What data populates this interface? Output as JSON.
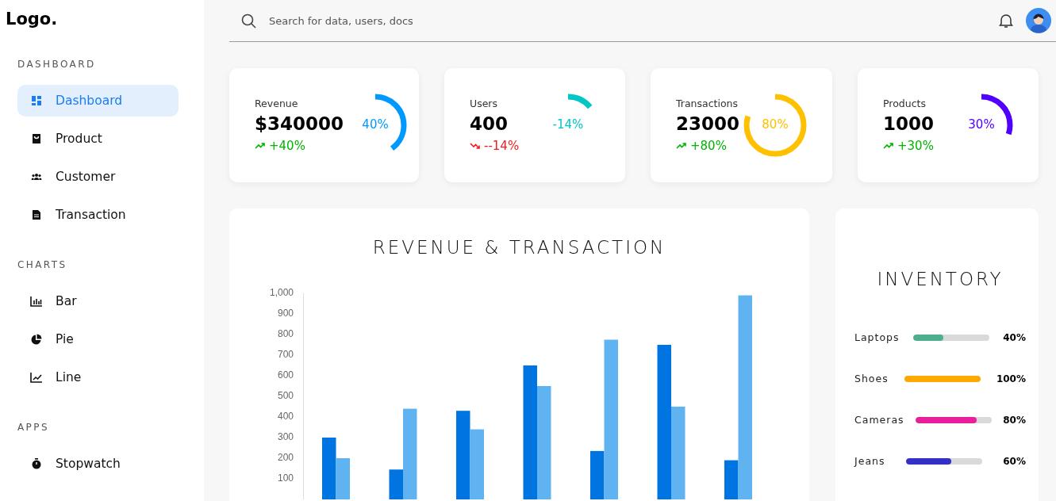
{
  "logo": "Logo.",
  "sidebar": {
    "sections": [
      {
        "title": "DASHBOARD",
        "items": [
          {
            "label": "Dashboard",
            "selected": true
          },
          {
            "label": "Product",
            "selected": false
          },
          {
            "label": "Customer",
            "selected": false
          },
          {
            "label": "Transaction",
            "selected": false
          }
        ]
      },
      {
        "title": "CHARTS",
        "items": [
          {
            "label": "Bar",
            "selected": false
          },
          {
            "label": "Pie",
            "selected": false
          },
          {
            "label": "Line",
            "selected": false
          }
        ]
      },
      {
        "title": "APPS",
        "items": [
          {
            "label": "Stopwatch",
            "selected": false
          }
        ]
      }
    ]
  },
  "header": {
    "search": {
      "placeholder": "Search for data, users, docs"
    }
  },
  "cards": [
    {
      "label": "Revenue",
      "value": "$340000",
      "rising": true,
      "change": "+40%",
      "level": 0.4,
      "percent": "40%",
      "color": "#0099ff"
    },
    {
      "label": "Users",
      "value": "400",
      "rising": false,
      "change": "--14%",
      "level": 0.14,
      "percent": "-14%",
      "color": "#00c6c6"
    },
    {
      "label": "Transactions",
      "value": "23000",
      "rising": true,
      "change": "+80%",
      "level": 0.8,
      "percent": "80%",
      "color": "#ffc000"
    },
    {
      "label": "Products",
      "value": "1000",
      "rising": true,
      "change": "+30%",
      "level": 0.3,
      "percent": "30%",
      "color": "#5000ff"
    }
  ],
  "revenue_chart": {
    "chart_data": {
      "type": "bar",
      "title": "REVENUE & TRANSACTION",
      "ylim": [
        0,
        1000
      ],
      "yticks": [
        100,
        200,
        300,
        400,
        500,
        600,
        700,
        800,
        900,
        {
          "value": 1000,
          "label": "1,000"
        }
      ],
      "series": [
        {
          "color": "#0074e0",
          "values": [
            300,
            145,
            430,
            650,
            235,
            750,
            190
          ]
        },
        {
          "color": "#5eb3f0",
          "values": [
            200,
            440,
            340,
            550,
            775,
            450,
            990
          ]
        }
      ]
    }
  },
  "inventory": {
    "title": "INVENTORY",
    "items": [
      {
        "label": "Laptops",
        "level": 0.4,
        "reading": "40%",
        "color": "#4caf8f"
      },
      {
        "label": "Shoes",
        "level": 1,
        "reading": "100%",
        "color": "#ffa800"
      },
      {
        "label": "Cameras",
        "level": 0.8,
        "reading": "80%",
        "color": "#e91e9c"
      },
      {
        "label": "Jeans",
        "level": 0.6,
        "reading": "60%",
        "color": "#3330c8"
      }
    ]
  }
}
